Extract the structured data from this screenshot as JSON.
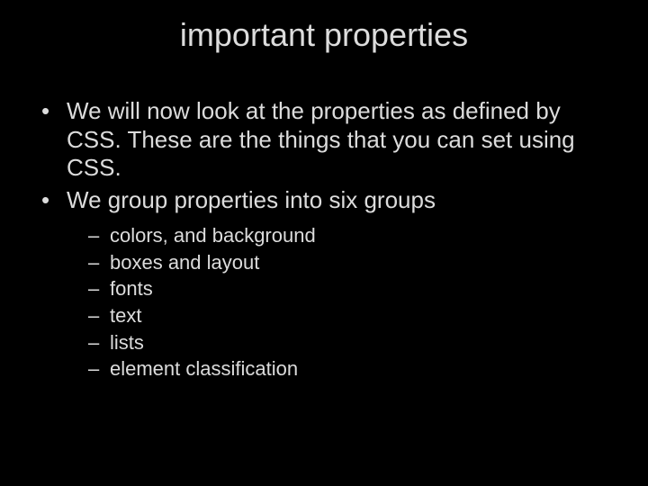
{
  "title": "important properties",
  "bullets": [
    "We will now look at the properties as defined by CSS. These are the things that you can set using CSS.",
    "We group properties into six groups"
  ],
  "sub_bullets": [
    "colors, and background",
    "boxes and layout",
    "fonts",
    "text",
    "lists",
    "element classification"
  ]
}
